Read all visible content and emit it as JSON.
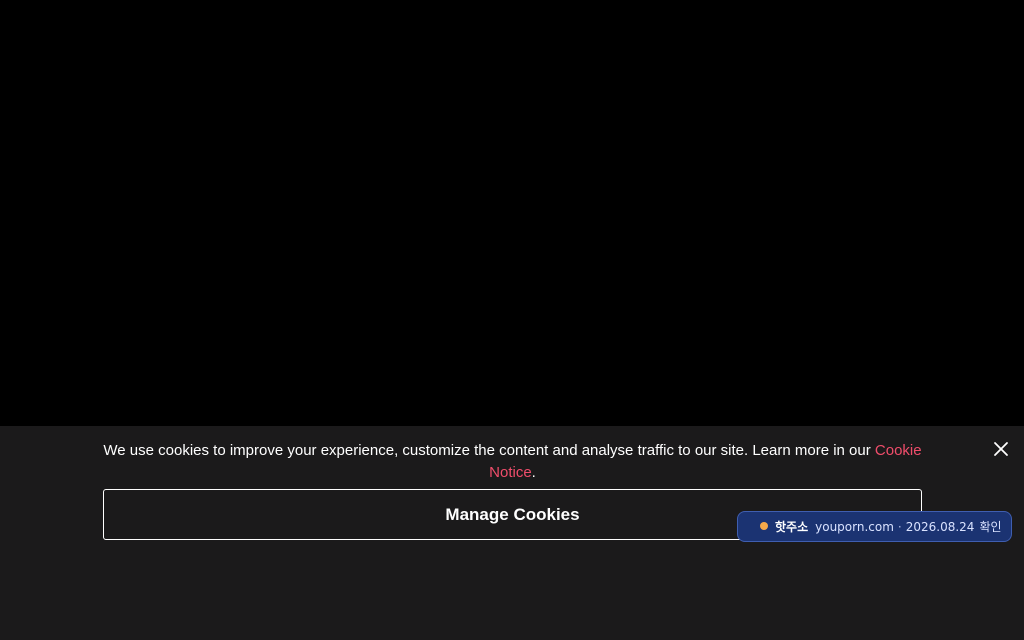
{
  "cookie_banner": {
    "message": "We use cookies to improve your experience, customize the content and analyse traffic to our site. Learn more in our ",
    "link_text": "Cookie Notice",
    "message_end": ".",
    "manage_button_label": "Manage Cookies",
    "close_icon": "close-icon",
    "link_color": "#f04d6b",
    "background_color": "#1b1a1b"
  },
  "hot_badge": {
    "title": "핫주소",
    "domain": "youporn.com",
    "separator": "·",
    "date": "2026.08.24",
    "confirm_label": "확인",
    "dot_color": "#f5a84a",
    "background_color": "#1b3372"
  }
}
